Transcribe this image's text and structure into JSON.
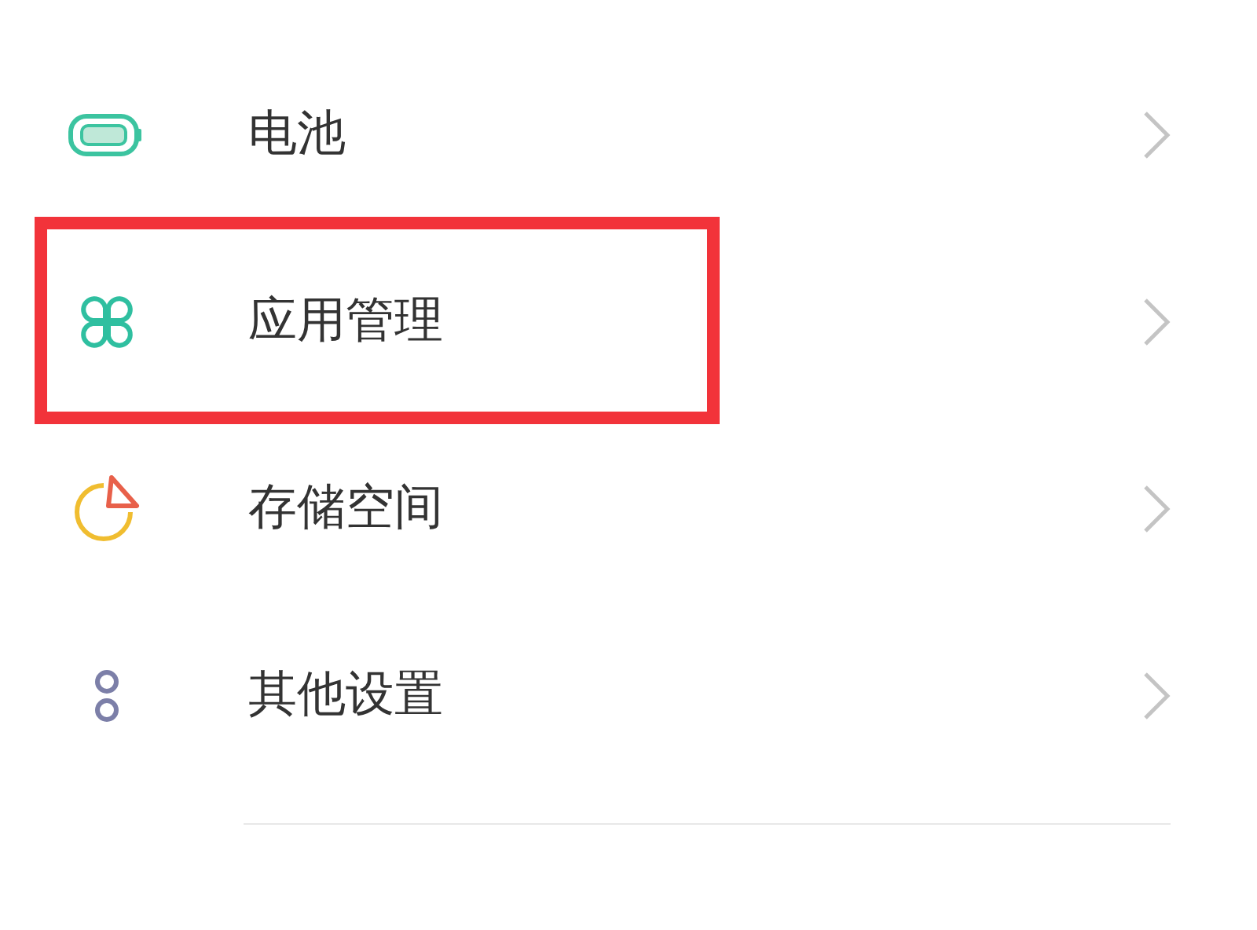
{
  "settings_items": [
    {
      "label": "电池",
      "kind": "battery",
      "highlighted": false
    },
    {
      "label": "应用管理",
      "kind": "apps",
      "highlighted": true
    },
    {
      "label": "存储空间",
      "kind": "storage",
      "highlighted": false
    },
    {
      "label": "其他设置",
      "kind": "more",
      "highlighted": false
    }
  ]
}
